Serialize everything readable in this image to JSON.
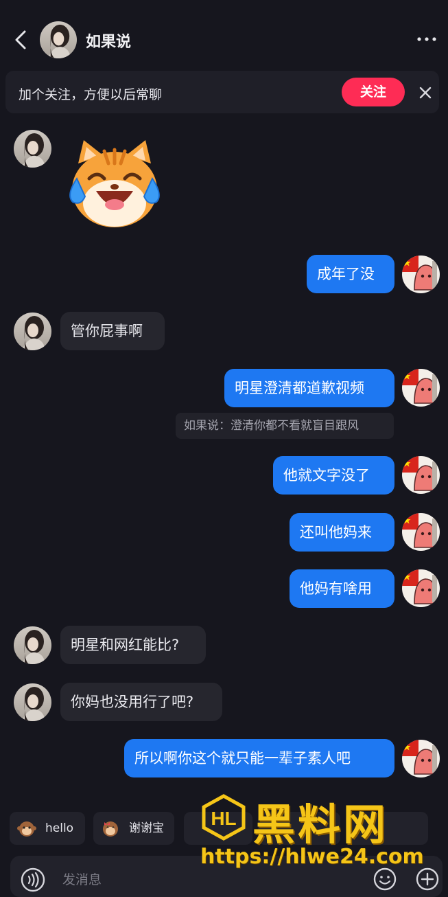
{
  "header": {
    "contact_name": "如果说"
  },
  "banner": {
    "text": "加个关注，方便以后常聊",
    "follow_label": "关注"
  },
  "messages": [
    {
      "from": "them",
      "type": "sticker",
      "sticker": "laughing-crying-cat"
    },
    {
      "from": "me",
      "text": "成年了没"
    },
    {
      "from": "them",
      "text": "管你屁事啊"
    },
    {
      "from": "me",
      "text": "明星澄清都道歉视频",
      "quote": "如果说：澄清你都不看就盲目跟风"
    },
    {
      "from": "me",
      "text": "他就文字没了"
    },
    {
      "from": "me",
      "text": "还叫他妈来"
    },
    {
      "from": "me",
      "text": "他妈有啥用"
    },
    {
      "from": "them",
      "text": "明星和网红能比?"
    },
    {
      "from": "them",
      "text": "你妈也没用行了吧?"
    },
    {
      "from": "me",
      "text": "所以啊你这个就只能一辈子素人吧"
    }
  ],
  "quick_replies": [
    {
      "label": "hello",
      "icon": "monkey-wave-icon"
    },
    {
      "label": "谢谢宝",
      "icon": "monkey-bow-icon"
    }
  ],
  "input": {
    "placeholder": "发消息"
  },
  "watermark": {
    "text": "黑料网",
    "url": "https://hlwe24.com"
  },
  "colors": {
    "background": "#16161e",
    "outgoing": "#1e78f2",
    "incoming": "#26262e",
    "follow": "#fe2c55",
    "watermark": "#f5c518"
  }
}
